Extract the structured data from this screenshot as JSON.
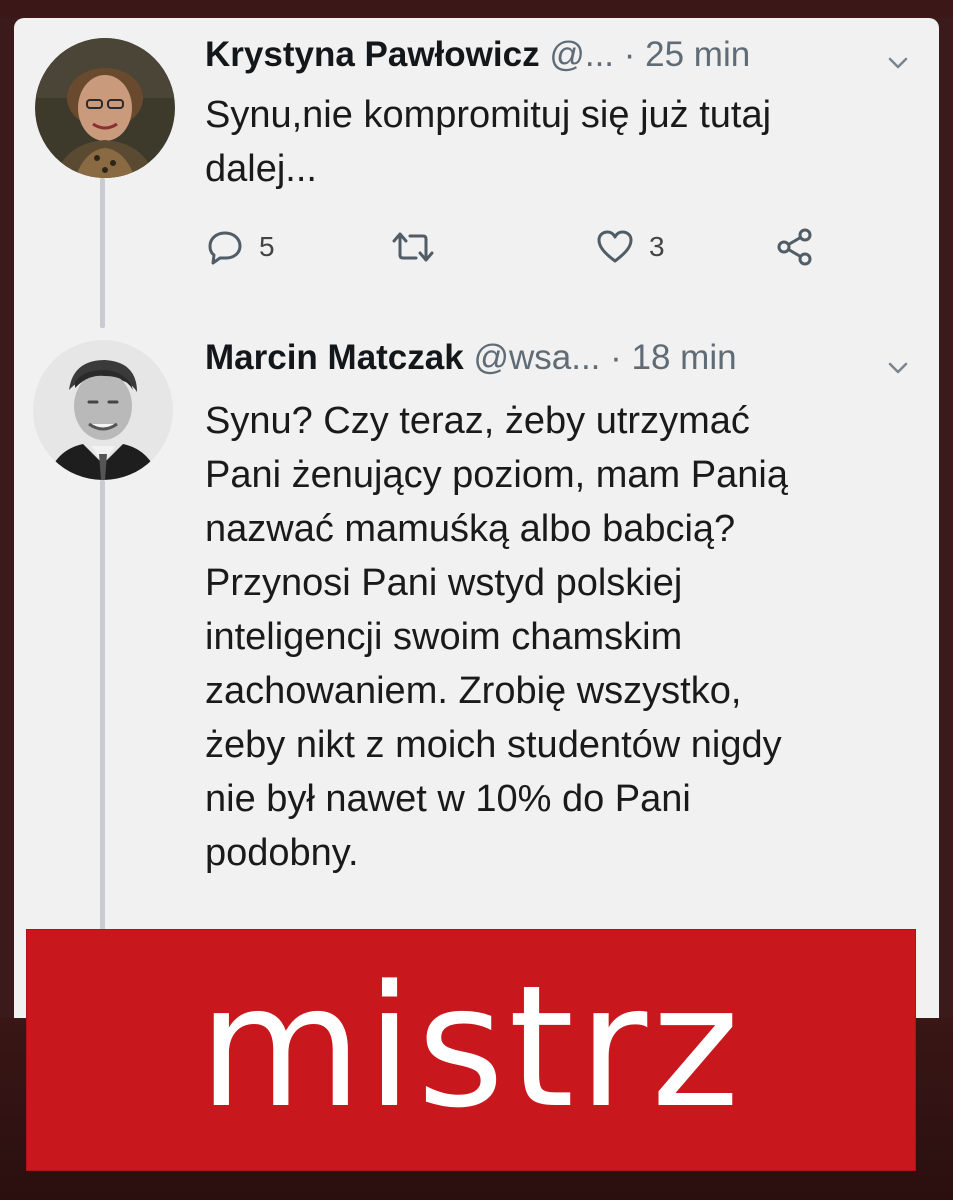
{
  "tweets": [
    {
      "name": "Krystyna Pawłowicz",
      "handle": "@...",
      "separator": "·",
      "time": "25 min",
      "text_lines": [
        "Synu,nie kompromituj się już tutaj",
        "dalej..."
      ],
      "actions": {
        "reply_count": "5",
        "retweet_count": "",
        "like_count": "3"
      }
    },
    {
      "name": "Marcin Matczak",
      "handle": "@wsa...",
      "separator": "·",
      "time": "18 min",
      "text_lines": [
        "Synu? Czy teraz, żeby utrzymać",
        "Pani żenujący poziom, mam Panią",
        "nazwać mamuśką albo babcią?",
        "Przynosi Pani wstyd polskiej",
        "inteligencji swoim chamskim",
        "zachowaniem. Zrobię wszystko,",
        "żeby nikt z moich studentów nigdy",
        "nie był nawet w 10% do Pani",
        "podobny."
      ]
    }
  ],
  "banner": {
    "text": "mistrz",
    "background": "#c8171d",
    "color": "#ffffff"
  },
  "icons": {
    "reply": "reply-icon",
    "retweet": "retweet-icon",
    "like": "heart-icon",
    "share": "share-icon",
    "menu": "chevron-down-icon"
  }
}
